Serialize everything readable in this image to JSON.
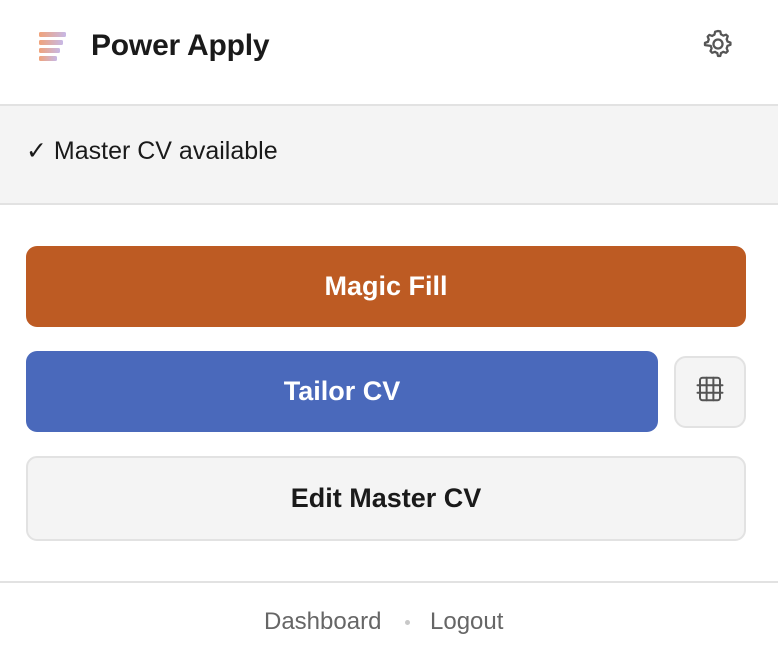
{
  "app": {
    "title": "Power Apply"
  },
  "status": {
    "text": "✓ Master CV available"
  },
  "actions": {
    "magic_fill": "Magic Fill",
    "tailor_cv": "Tailor CV",
    "edit_master_cv": "Edit Master CV"
  },
  "footer": {
    "dashboard": "Dashboard",
    "logout": "Logout"
  },
  "icons": {
    "settings": "gear-icon",
    "grid": "grid-icon",
    "logo": "logo-icon"
  },
  "colors": {
    "magic_fill": "#bd5b23",
    "tailor_cv": "#4a69bb",
    "surface": "#f4f4f4",
    "border": "#e2e2e2"
  }
}
